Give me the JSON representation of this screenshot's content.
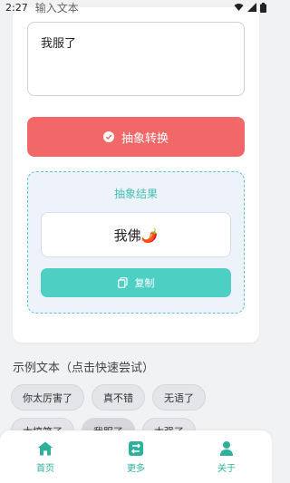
{
  "status_bar": {
    "time": "2:27",
    "partial_label": "输入文本"
  },
  "input": {
    "value": "我服了"
  },
  "convert_button": {
    "label": "抽象转换"
  },
  "result": {
    "title": "抽象结果",
    "output": "我佛🌶️",
    "copy_label": "复制"
  },
  "examples": {
    "title": "示例文本（点击快速尝试）",
    "row1": [
      "你太厉害了",
      "真不错",
      "无语了"
    ],
    "row2": [
      "太搞笑了",
      "我服了",
      "太强了"
    ],
    "selected": "我服了"
  },
  "bottom_nav": {
    "items": [
      {
        "label": "首页",
        "icon": "home-icon"
      },
      {
        "label": "更多",
        "icon": "swap-icon"
      },
      {
        "label": "关于",
        "icon": "person-icon"
      }
    ]
  },
  "colors": {
    "convert_button": "#f26868",
    "accent_teal": "#4ecfc3",
    "nav_green": "#2fb09a"
  }
}
